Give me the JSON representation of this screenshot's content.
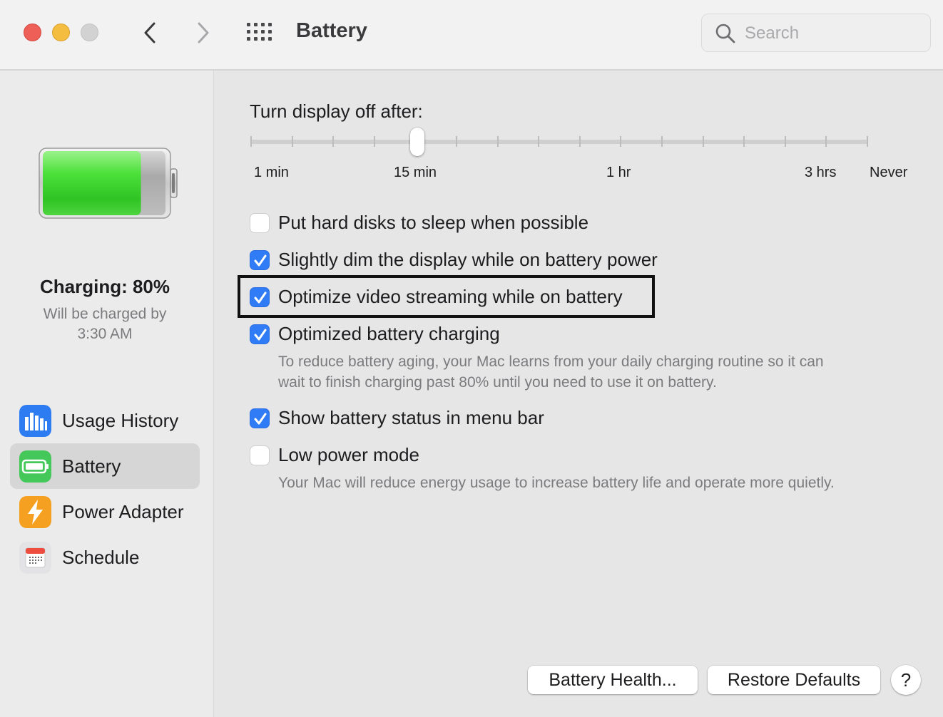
{
  "window": {
    "title": "Battery",
    "search_placeholder": "Search"
  },
  "sidebar": {
    "status_title": "Charging: 80%",
    "status_line1": "Will be charged by",
    "status_line2": "3:30 AM",
    "battery_level_fraction": 0.8,
    "items": [
      {
        "label": "Usage History",
        "icon": "bar-chart-icon",
        "selected": false
      },
      {
        "label": "Battery",
        "icon": "battery-icon",
        "selected": true
      },
      {
        "label": "Power Adapter",
        "icon": "lightning-bolt-icon",
        "selected": false
      },
      {
        "label": "Schedule",
        "icon": "calendar-icon",
        "selected": false
      }
    ]
  },
  "main": {
    "slider": {
      "label": "Turn display off after:",
      "tick_labels": [
        "1 min",
        "15 min",
        "1 hr",
        "3 hrs",
        "Never"
      ],
      "value": "15 min",
      "tick_count": 16
    },
    "options": [
      {
        "label": "Put hard disks to sleep when possible",
        "checked": false
      },
      {
        "label": "Slightly dim the display while on battery power",
        "checked": true
      },
      {
        "label": "Optimize video streaming while on battery",
        "checked": true,
        "highlighted": true
      },
      {
        "label": "Optimized battery charging",
        "checked": true,
        "description_line1": "To reduce battery aging, your Mac learns from your daily charging routine so it can",
        "description_line2": "wait to finish charging past 80% until you need to use it on battery."
      },
      {
        "label": "Show battery status in menu bar",
        "checked": true
      },
      {
        "label": "Low power mode",
        "checked": false,
        "description_line1": "Your Mac will reduce energy usage to increase battery life and operate more quietly."
      }
    ],
    "buttons": {
      "battery_health": "Battery Health...",
      "restore_defaults": "Restore Defaults",
      "help": "?"
    }
  },
  "colors": {
    "accent": "#2f7cf6",
    "traffic_red": "#ed5f57",
    "traffic_yellow": "#f4bd3f",
    "battery_green": "#3bd12f"
  }
}
